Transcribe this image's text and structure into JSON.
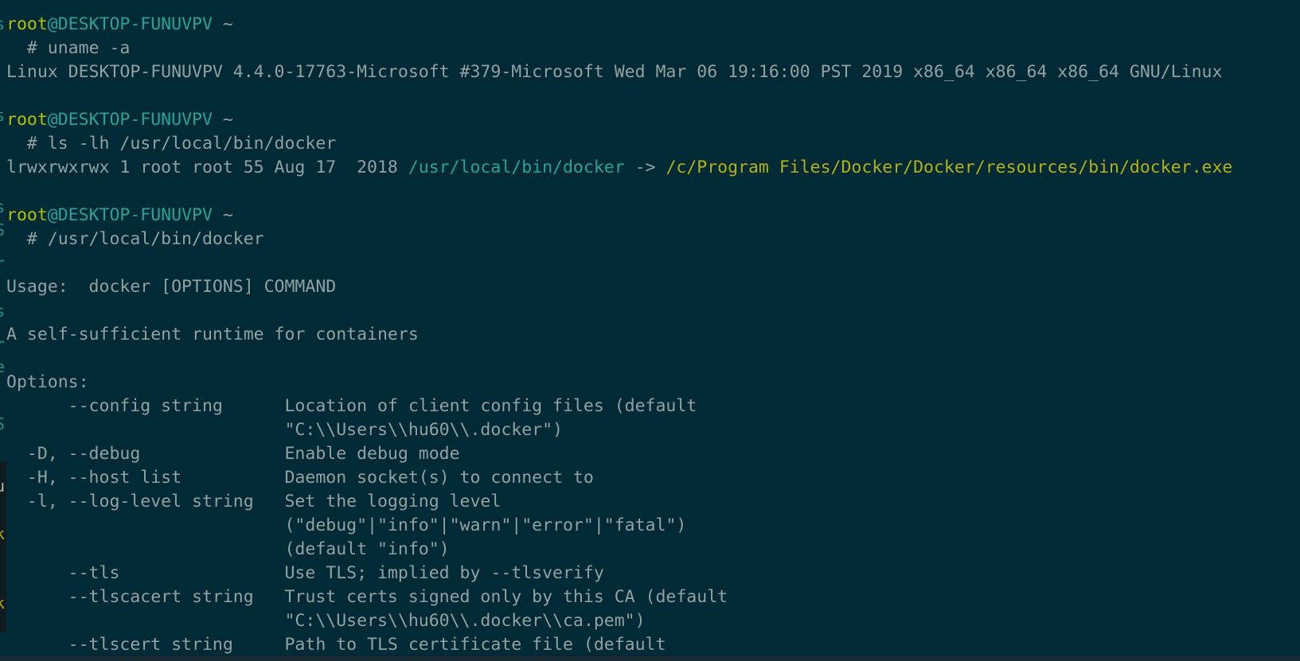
{
  "terminal": {
    "prompt": {
      "user": "root",
      "at": "@",
      "host": "DESKTOP-FUNUVPV",
      "tilde": "~",
      "symbol": "  #"
    },
    "blocks": [
      {
        "command": " uname -a",
        "output": "Linux DESKTOP-FUNUVPV 4.4.0-17763-Microsoft #379-Microsoft Wed Mar 06 19:16:00 PST 2019 x86_64 x86_64 x86_64 GNU/Linux"
      },
      {
        "command": " ls -lh /usr/local/bin/docker",
        "output_prefix": "lrwxrwxrwx 1 root root 55 Aug 17  2018 ",
        "output_link": "/usr/local/bin/docker",
        "output_arrow": " -> ",
        "output_target": "/c/Program Files/Docker/Docker/resources/bin/docker.exe"
      },
      {
        "command": " /usr/local/bin/docker"
      }
    ],
    "docker_help": {
      "usage": "Usage:  docker [OPTIONS] COMMAND",
      "description": "A self-sufficient runtime for containers",
      "options_header": "Options:",
      "options": [
        "      --config string      Location of client config files (default",
        "                           \"C:\\\\Users\\\\hu60\\\\.docker\")",
        "  -D, --debug              Enable debug mode",
        "  -H, --host list          Daemon socket(s) to connect to",
        "  -l, --log-level string   Set the logging level",
        "                           (\"debug\"|\"info\"|\"warn\"|\"error\"|\"fatal\")",
        "                           (default \"info\")",
        "      --tls                Use TLS; implied by --tlsverify",
        "      --tlscacert string   Trust certs signed only by this CA (default",
        "                           \"C:\\\\Users\\\\hu60\\\\.docker\\\\ca.pem\")",
        "      --tlscert string     Path to TLS certificate file (default"
      ]
    }
  },
  "left_edge_fragments": [
    "s",
    "s",
    "s",
    "S",
    "r",
    "s",
    "r",
    "e",
    "S",
    "u",
    "k",
    "k"
  ]
}
